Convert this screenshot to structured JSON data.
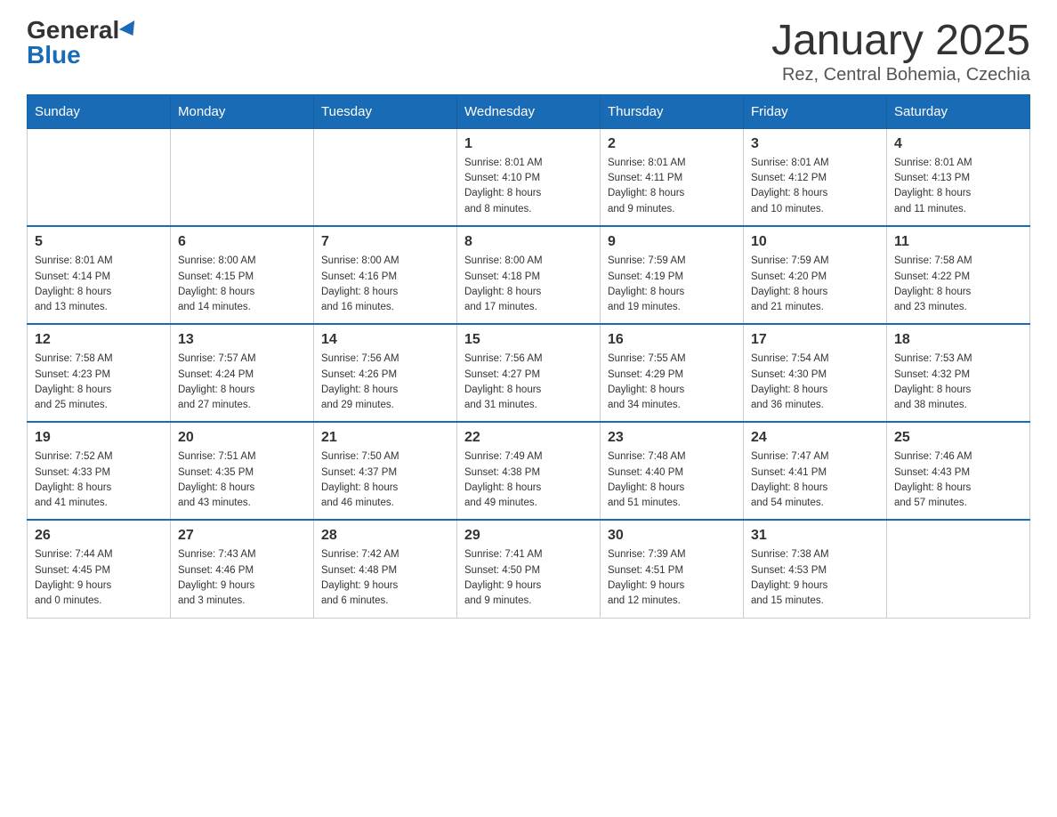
{
  "header": {
    "logo_general": "General",
    "logo_blue": "Blue",
    "month_title": "January 2025",
    "location": "Rez, Central Bohemia, Czechia"
  },
  "weekdays": [
    "Sunday",
    "Monday",
    "Tuesday",
    "Wednesday",
    "Thursday",
    "Friday",
    "Saturday"
  ],
  "weeks": [
    [
      {
        "day": "",
        "info": ""
      },
      {
        "day": "",
        "info": ""
      },
      {
        "day": "",
        "info": ""
      },
      {
        "day": "1",
        "info": "Sunrise: 8:01 AM\nSunset: 4:10 PM\nDaylight: 8 hours\nand 8 minutes."
      },
      {
        "day": "2",
        "info": "Sunrise: 8:01 AM\nSunset: 4:11 PM\nDaylight: 8 hours\nand 9 minutes."
      },
      {
        "day": "3",
        "info": "Sunrise: 8:01 AM\nSunset: 4:12 PM\nDaylight: 8 hours\nand 10 minutes."
      },
      {
        "day": "4",
        "info": "Sunrise: 8:01 AM\nSunset: 4:13 PM\nDaylight: 8 hours\nand 11 minutes."
      }
    ],
    [
      {
        "day": "5",
        "info": "Sunrise: 8:01 AM\nSunset: 4:14 PM\nDaylight: 8 hours\nand 13 minutes."
      },
      {
        "day": "6",
        "info": "Sunrise: 8:00 AM\nSunset: 4:15 PM\nDaylight: 8 hours\nand 14 minutes."
      },
      {
        "day": "7",
        "info": "Sunrise: 8:00 AM\nSunset: 4:16 PM\nDaylight: 8 hours\nand 16 minutes."
      },
      {
        "day": "8",
        "info": "Sunrise: 8:00 AM\nSunset: 4:18 PM\nDaylight: 8 hours\nand 17 minutes."
      },
      {
        "day": "9",
        "info": "Sunrise: 7:59 AM\nSunset: 4:19 PM\nDaylight: 8 hours\nand 19 minutes."
      },
      {
        "day": "10",
        "info": "Sunrise: 7:59 AM\nSunset: 4:20 PM\nDaylight: 8 hours\nand 21 minutes."
      },
      {
        "day": "11",
        "info": "Sunrise: 7:58 AM\nSunset: 4:22 PM\nDaylight: 8 hours\nand 23 minutes."
      }
    ],
    [
      {
        "day": "12",
        "info": "Sunrise: 7:58 AM\nSunset: 4:23 PM\nDaylight: 8 hours\nand 25 minutes."
      },
      {
        "day": "13",
        "info": "Sunrise: 7:57 AM\nSunset: 4:24 PM\nDaylight: 8 hours\nand 27 minutes."
      },
      {
        "day": "14",
        "info": "Sunrise: 7:56 AM\nSunset: 4:26 PM\nDaylight: 8 hours\nand 29 minutes."
      },
      {
        "day": "15",
        "info": "Sunrise: 7:56 AM\nSunset: 4:27 PM\nDaylight: 8 hours\nand 31 minutes."
      },
      {
        "day": "16",
        "info": "Sunrise: 7:55 AM\nSunset: 4:29 PM\nDaylight: 8 hours\nand 34 minutes."
      },
      {
        "day": "17",
        "info": "Sunrise: 7:54 AM\nSunset: 4:30 PM\nDaylight: 8 hours\nand 36 minutes."
      },
      {
        "day": "18",
        "info": "Sunrise: 7:53 AM\nSunset: 4:32 PM\nDaylight: 8 hours\nand 38 minutes."
      }
    ],
    [
      {
        "day": "19",
        "info": "Sunrise: 7:52 AM\nSunset: 4:33 PM\nDaylight: 8 hours\nand 41 minutes."
      },
      {
        "day": "20",
        "info": "Sunrise: 7:51 AM\nSunset: 4:35 PM\nDaylight: 8 hours\nand 43 minutes."
      },
      {
        "day": "21",
        "info": "Sunrise: 7:50 AM\nSunset: 4:37 PM\nDaylight: 8 hours\nand 46 minutes."
      },
      {
        "day": "22",
        "info": "Sunrise: 7:49 AM\nSunset: 4:38 PM\nDaylight: 8 hours\nand 49 minutes."
      },
      {
        "day": "23",
        "info": "Sunrise: 7:48 AM\nSunset: 4:40 PM\nDaylight: 8 hours\nand 51 minutes."
      },
      {
        "day": "24",
        "info": "Sunrise: 7:47 AM\nSunset: 4:41 PM\nDaylight: 8 hours\nand 54 minutes."
      },
      {
        "day": "25",
        "info": "Sunrise: 7:46 AM\nSunset: 4:43 PM\nDaylight: 8 hours\nand 57 minutes."
      }
    ],
    [
      {
        "day": "26",
        "info": "Sunrise: 7:44 AM\nSunset: 4:45 PM\nDaylight: 9 hours\nand 0 minutes."
      },
      {
        "day": "27",
        "info": "Sunrise: 7:43 AM\nSunset: 4:46 PM\nDaylight: 9 hours\nand 3 minutes."
      },
      {
        "day": "28",
        "info": "Sunrise: 7:42 AM\nSunset: 4:48 PM\nDaylight: 9 hours\nand 6 minutes."
      },
      {
        "day": "29",
        "info": "Sunrise: 7:41 AM\nSunset: 4:50 PM\nDaylight: 9 hours\nand 9 minutes."
      },
      {
        "day": "30",
        "info": "Sunrise: 7:39 AM\nSunset: 4:51 PM\nDaylight: 9 hours\nand 12 minutes."
      },
      {
        "day": "31",
        "info": "Sunrise: 7:38 AM\nSunset: 4:53 PM\nDaylight: 9 hours\nand 15 minutes."
      },
      {
        "day": "",
        "info": ""
      }
    ]
  ]
}
